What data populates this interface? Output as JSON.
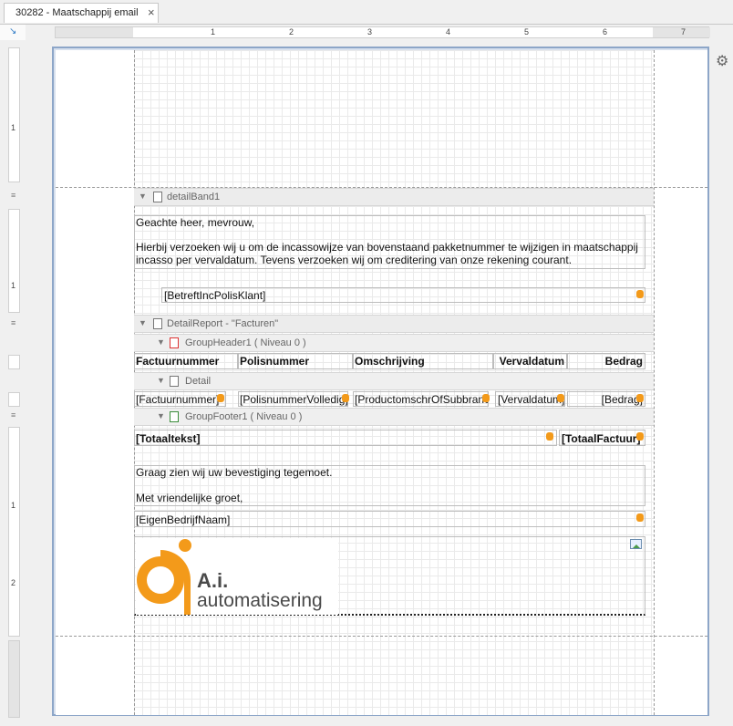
{
  "tab": {
    "title": "30282 - Maatschappij email",
    "close": "×"
  },
  "ruler": {
    "h_numbers": [
      "1",
      "2",
      "3",
      "4",
      "5",
      "6",
      "7"
    ],
    "v_numbers": [
      "1",
      "1",
      "1",
      "2"
    ]
  },
  "bands": {
    "detail_band": "detailBand1",
    "detail_report": "DetailReport - \"Facturen\"",
    "group_header": "GroupHeader1 ( Niveau 0 )",
    "detail": "Detail",
    "group_footer": "GroupFooter1 ( Niveau 0 )"
  },
  "letter": {
    "greeting": "Geachte heer, mevrouw,",
    "body_line1": "Hierbij verzoeken wij u om de incassowijze van bovenstaand pakketnummer te wijzigen in maatschappij",
    "body_line2": "incasso per vervaldatum. Tevens verzoeken wij om creditering van onze rekening courant.",
    "betreft_field": "[BetreftIncPolisKlant]",
    "closing1": "Graag zien wij uw bevestiging tegemoet.",
    "closing2": "Met vriendelijke groet,",
    "company_field": "[EigenBedrijfNaam]"
  },
  "table": {
    "headers": [
      "Factuurnummer",
      "Polisnummer",
      "Omschrijving",
      "Vervaldatum",
      "Bedrag"
    ],
    "fields": [
      "[Factuurnummer]",
      "[PolisnummerVolledig]",
      "[ProductomschrOfSubbranche]",
      "[Vervaldatum]",
      "[Bedrag]"
    ],
    "footer_label": "[Totaaltekst]",
    "footer_total": "[TotaalFactuur]"
  },
  "logo": {
    "line1": "A.i.",
    "line2": "automatisering",
    "mark": "ai"
  },
  "colors": {
    "accent": "#f39a1a",
    "logo_text": "#4a4a4a",
    "frame": "#8da6c8"
  },
  "icons": [
    "close-icon",
    "settings-gear-icon",
    "database-field-icon",
    "picture-icon",
    "band-icon",
    "collapse-arrow-icon"
  ]
}
